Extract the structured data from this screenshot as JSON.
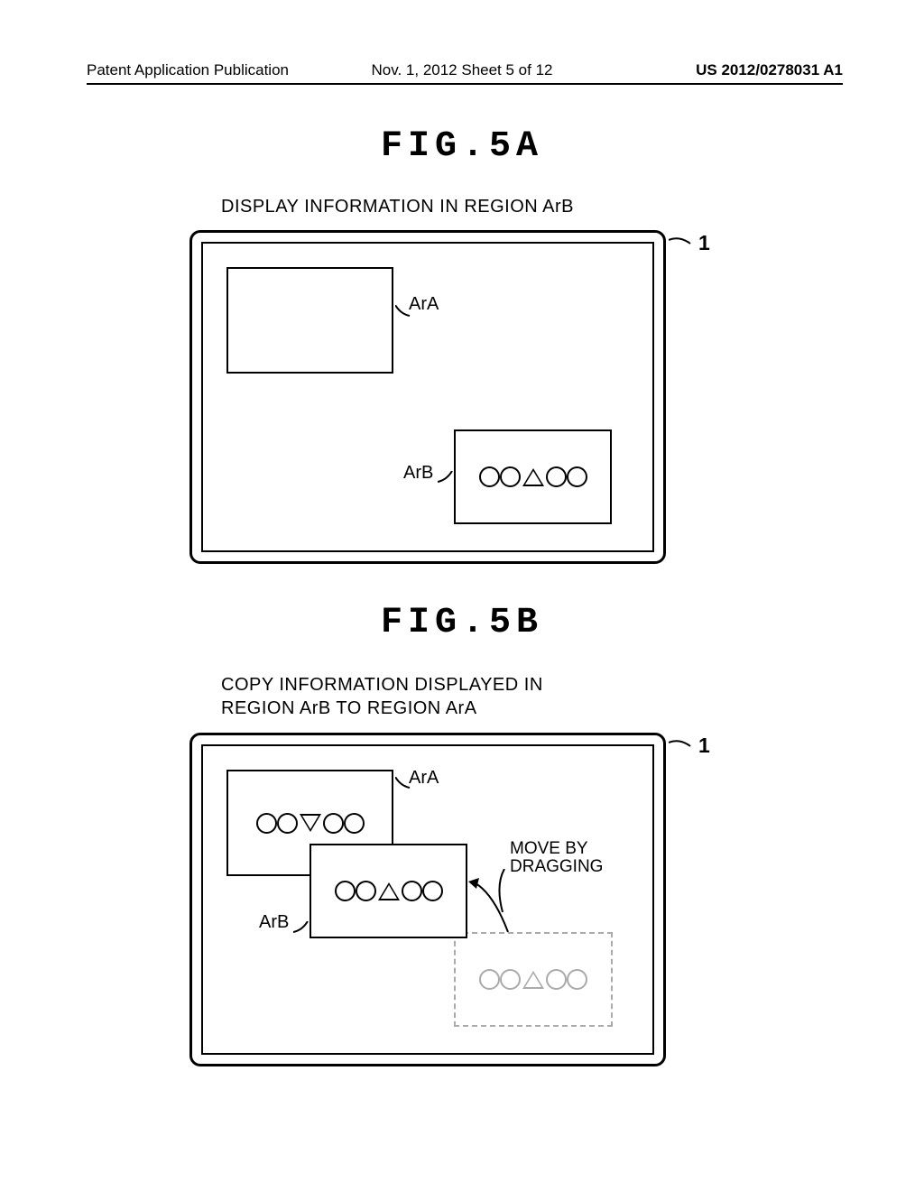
{
  "header": {
    "left": "Patent Application Publication",
    "center": "Nov. 1, 2012  Sheet 5 of 12",
    "right": "US 2012/0278031 A1"
  },
  "fig5a": {
    "label": "FIG.5A",
    "caption": "DISPLAY INFORMATION IN REGION ArB",
    "ara_label": "ArA",
    "arb_label": "ArB",
    "ref_1": "1"
  },
  "fig5b": {
    "label": "FIG.5B",
    "caption_line1": "COPY INFORMATION DISPLAYED IN",
    "caption_line2": "REGION ArB TO REGION ArA",
    "ara_label": "ArA",
    "arb_label": "ArB",
    "ref_1": "1",
    "move_line1": "MOVE BY",
    "move_line2": "DRAGGING"
  }
}
